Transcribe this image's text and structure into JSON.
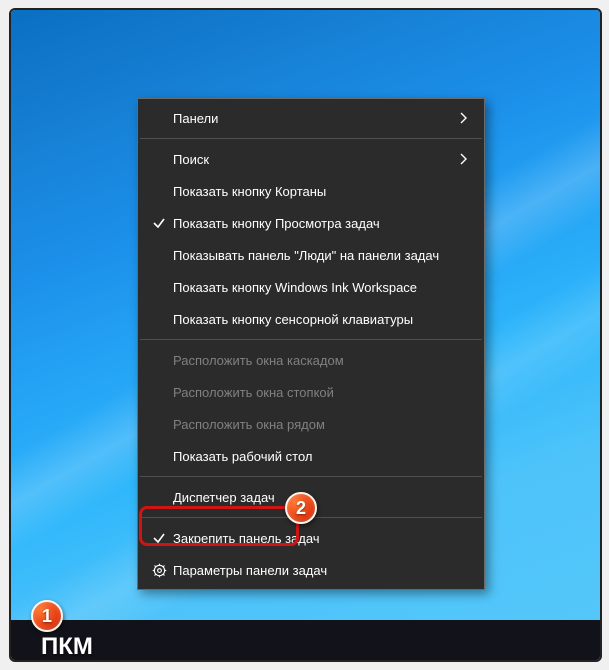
{
  "annotation": {
    "badge1": "1",
    "badge2": "2",
    "pkm": "ПКМ"
  },
  "menu": {
    "panels": "Панели",
    "search": "Поиск",
    "show_cortana": "Показать кнопку Кортаны",
    "show_taskview": "Показать кнопку Просмотра задач",
    "show_people": "Показывать панель \"Люди\" на панели задач",
    "show_ink": "Показать кнопку Windows Ink Workspace",
    "show_touch_kb": "Показать кнопку сенсорной клавиатуры",
    "cascade": "Расположить окна каскадом",
    "stacked": "Расположить окна стопкой",
    "side_by_side": "Расположить окна рядом",
    "show_desktop": "Показать рабочий стол",
    "task_manager": "Диспетчер задач",
    "lock_taskbar": "Закрепить панель задач",
    "taskbar_settings": "Параметры панели задач"
  }
}
